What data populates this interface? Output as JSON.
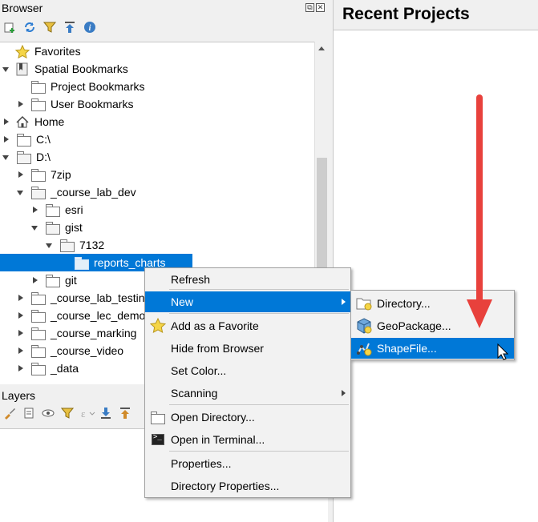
{
  "browser": {
    "title": "Browser",
    "dock_float": "⧉",
    "dock_close": "✕",
    "toolbar_icons": [
      "add-layer-icon",
      "refresh-icon",
      "filter-icon",
      "collapse-all-icon",
      "info-icon"
    ],
    "tree": [
      {
        "label": "Favorites",
        "icon": "star-icon",
        "indent": 0,
        "arrow": "none"
      },
      {
        "label": "Spatial Bookmarks",
        "icon": "bookmark-icon",
        "indent": 0,
        "arrow": "down"
      },
      {
        "label": "Project Bookmarks",
        "icon": "folder-icon",
        "indent": 1,
        "arrow": "none"
      },
      {
        "label": "User Bookmarks",
        "icon": "folder-icon",
        "indent": 1,
        "arrow": "right"
      },
      {
        "label": "Home",
        "icon": "home-icon",
        "indent": 0,
        "arrow": "right"
      },
      {
        "label": "C:\\",
        "icon": "folder-icon",
        "indent": 0,
        "arrow": "right"
      },
      {
        "label": "D:\\",
        "icon": "folder-icon",
        "indent": 0,
        "arrow": "down"
      },
      {
        "label": "7zip",
        "icon": "folder-icon",
        "indent": 1,
        "arrow": "right"
      },
      {
        "label": "_course_lab_dev",
        "icon": "folder-icon",
        "indent": 1,
        "arrow": "down"
      },
      {
        "label": "esri",
        "icon": "folder-icon",
        "indent": 2,
        "arrow": "right"
      },
      {
        "label": "gist",
        "icon": "folder-icon",
        "indent": 2,
        "arrow": "down"
      },
      {
        "label": "7132",
        "icon": "folder-icon",
        "indent": 3,
        "arrow": "down"
      },
      {
        "label": "reports_charts",
        "icon": "folder-icon",
        "indent": 4,
        "arrow": "none",
        "selected": true
      },
      {
        "label": "git",
        "icon": "folder-icon",
        "indent": 2,
        "arrow": "right"
      },
      {
        "label": "_course_lab_testing",
        "icon": "folder-icon",
        "indent": 1,
        "arrow": "right"
      },
      {
        "label": "_course_lec_demo",
        "icon": "folder-icon",
        "indent": 1,
        "arrow": "right"
      },
      {
        "label": "_course_marking",
        "icon": "folder-icon",
        "indent": 1,
        "arrow": "right"
      },
      {
        "label": "_course_video",
        "icon": "folder-icon",
        "indent": 1,
        "arrow": "right"
      },
      {
        "label": "_data",
        "icon": "folder-icon",
        "indent": 1,
        "arrow": "right"
      }
    ]
  },
  "layers": {
    "title": "Layers"
  },
  "recent": {
    "title": "Recent Projects"
  },
  "context_menu": {
    "items": [
      {
        "label": "Refresh",
        "icon": "",
        "submenu": false
      },
      {
        "label": "New",
        "icon": "",
        "submenu": true,
        "active": true
      },
      {
        "label": "Add as a Favorite",
        "icon": "star-icon",
        "submenu": false
      },
      {
        "label": "Hide from Browser",
        "icon": "",
        "submenu": false
      },
      {
        "label": "Set Color...",
        "icon": "",
        "submenu": false
      },
      {
        "label": "Scanning",
        "icon": "",
        "submenu": true
      },
      {
        "label": "Open Directory...",
        "icon": "folder-icon",
        "submenu": false
      },
      {
        "label": "Open in Terminal...",
        "icon": "terminal-icon",
        "submenu": false
      },
      {
        "label": "Properties...",
        "icon": "",
        "submenu": false
      },
      {
        "label": "Directory Properties...",
        "icon": "",
        "submenu": false
      }
    ]
  },
  "new_submenu": {
    "items": [
      {
        "label": "Directory...",
        "icon": "new-folder-icon"
      },
      {
        "label": "GeoPackage...",
        "icon": "geopackage-icon"
      },
      {
        "label": "ShapeFile...",
        "icon": "shapefile-icon",
        "active": true
      }
    ]
  },
  "colors": {
    "selection": "#0078d7",
    "annotation_arrow": "#e8413c"
  }
}
